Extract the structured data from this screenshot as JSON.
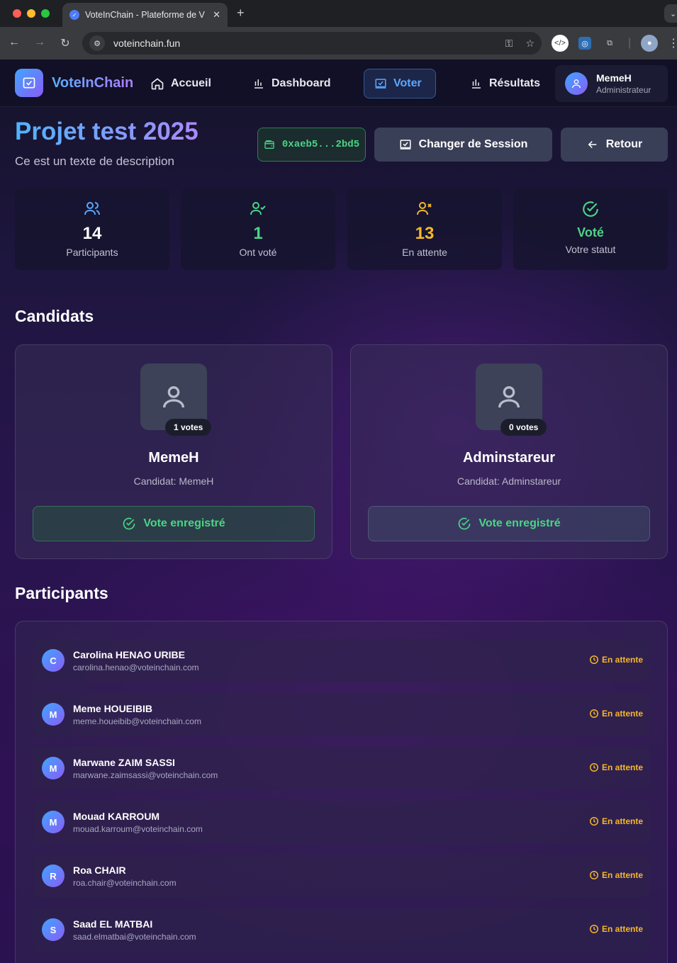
{
  "browser": {
    "tab_title": "VoteInChain - Plateforme de V",
    "url": "voteinchain.fun"
  },
  "nav": {
    "brand": "VoteInChain",
    "links": [
      {
        "label": "Accueil",
        "icon": "home-icon"
      },
      {
        "label": "Dashboard",
        "icon": "bar-chart-icon"
      },
      {
        "label": "Voter",
        "icon": "vote-box-icon",
        "active": true
      },
      {
        "label": "Résultats",
        "icon": "bar-chart-icon"
      }
    ],
    "user": {
      "name": "MemeH",
      "role": "Administrateur"
    }
  },
  "header": {
    "title": "Projet test 2025",
    "description": "Ce est un texte de description",
    "wallet": "0xaeb5...2bd5",
    "change_session": "Changer de Session",
    "back": "Retour"
  },
  "stats": [
    {
      "value": "14",
      "label": "Participants",
      "color": "#ffffff",
      "icon_color": "#5aa8ff",
      "icon": "users-icon"
    },
    {
      "value": "1",
      "label": "Ont voté",
      "color": "#4ad585",
      "icon_color": "#4ad585",
      "icon": "user-check-icon"
    },
    {
      "value": "13",
      "label": "En attente",
      "color": "#f5b829",
      "icon_color": "#f5b829",
      "icon": "user-x-icon"
    },
    {
      "value": "Voté",
      "label": "Votre statut",
      "color": "#4ad585",
      "icon_color": "#4ad585",
      "icon": "check-circle-icon"
    }
  ],
  "candidates_title": "Candidats",
  "candidates": [
    {
      "name": "MemeH",
      "votes": "1 votes",
      "subtitle": "Candidat: MemeH",
      "button": "Vote enregistré"
    },
    {
      "name": "Adminstareur",
      "votes": "0 votes",
      "subtitle": "Candidat: Adminstareur",
      "button": "Vote enregistré"
    }
  ],
  "participants_title": "Participants",
  "participants": [
    {
      "initial": "C",
      "name": "Carolina HENAO URIBE",
      "email": "carolina.henao@voteinchain.com",
      "status": "En attente"
    },
    {
      "initial": "M",
      "name": "Meme HOUEIBIB",
      "email": "meme.houeibib@voteinchain.com",
      "status": "En attente"
    },
    {
      "initial": "M",
      "name": "Marwane ZAIM SASSI",
      "email": "marwane.zaimsassi@voteinchain.com",
      "status": "En attente"
    },
    {
      "initial": "M",
      "name": "Mouad KARROUM",
      "email": "mouad.karroum@voteinchain.com",
      "status": "En attente"
    },
    {
      "initial": "R",
      "name": "Roa CHAIR",
      "email": "roa.chair@voteinchain.com",
      "status": "En attente"
    },
    {
      "initial": "S",
      "name": "Saad EL MATBAI",
      "email": "saad.elmatbai@voteinchain.com",
      "status": "En attente"
    }
  ]
}
